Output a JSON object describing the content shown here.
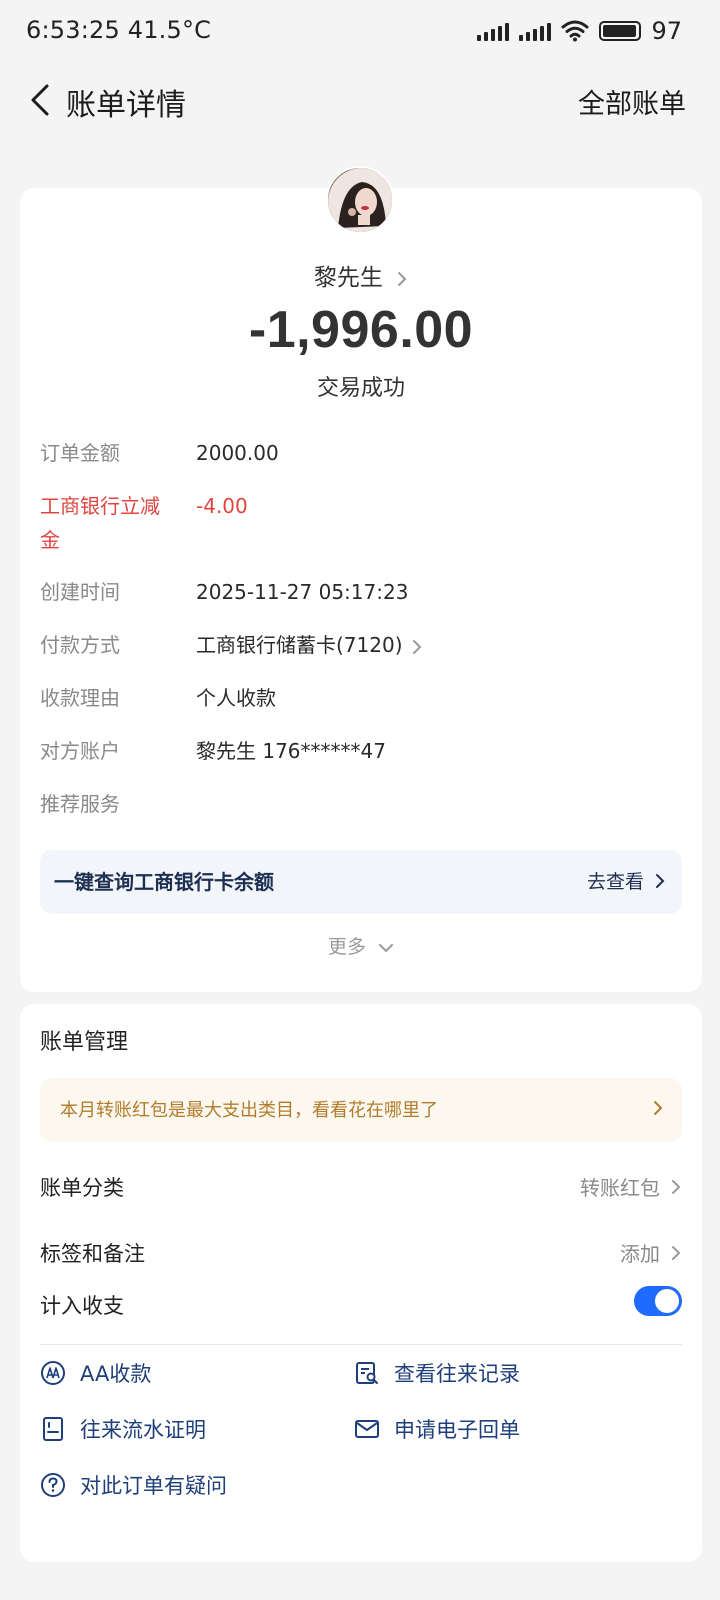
{
  "status_bar": {
    "time_temp": "6:53:25 41.5°C",
    "battery": "97",
    "battery_level": 0.97
  },
  "nav": {
    "title": "账单详情",
    "right_link": "全部账单",
    "back_icon": "back-arrow-icon"
  },
  "bill": {
    "payee": "黎先生",
    "amount": "-1,996.00",
    "status": "交易成功",
    "rows": [
      {
        "label": "订单金额",
        "value": "2000.00"
      },
      {
        "label_line1": "工商银行立减",
        "label_line2": "金",
        "value": "-4.00",
        "color": "#e0453f"
      },
      {
        "label": "创建时间",
        "value": "2025-11-27 05:17:23"
      },
      {
        "label": "付款方式",
        "value": "工商银行储蓄卡(7120)"
      },
      {
        "label": "收款理由",
        "value": "个人收款"
      },
      {
        "label": "对方账户",
        "value": "黎先生 176******47"
      },
      {
        "label": "推荐服务",
        "value": ""
      }
    ],
    "banner": {
      "text": "一键查询工商银行卡余额",
      "link": "去查看"
    },
    "more": "更多"
  },
  "manage": {
    "title": "账单管理",
    "tip": "本月转账红包是最大支出类目，看看花在哪里了",
    "category": {
      "label": "账单分类",
      "value": "转账红包"
    },
    "tags": {
      "label": "标签和备注",
      "value": "添加"
    },
    "include": {
      "label": "计入收支",
      "on": true
    },
    "actions": [
      {
        "label": "AA收款",
        "icon": "aa-icon"
      },
      {
        "label": "查看往来记录",
        "icon": "records-search-icon"
      },
      {
        "label": "往来流水证明",
        "icon": "statement-icon"
      },
      {
        "label": "申请电子回单",
        "icon": "mail-receipt-icon"
      },
      {
        "label": "对此订单有疑问",
        "icon": "question-icon"
      }
    ]
  },
  "colors": {
    "accent": "#1f6bff",
    "discount_red": "#e0453f",
    "tip_text": "#b27d2b",
    "link_navy": "#1f3f7a"
  }
}
